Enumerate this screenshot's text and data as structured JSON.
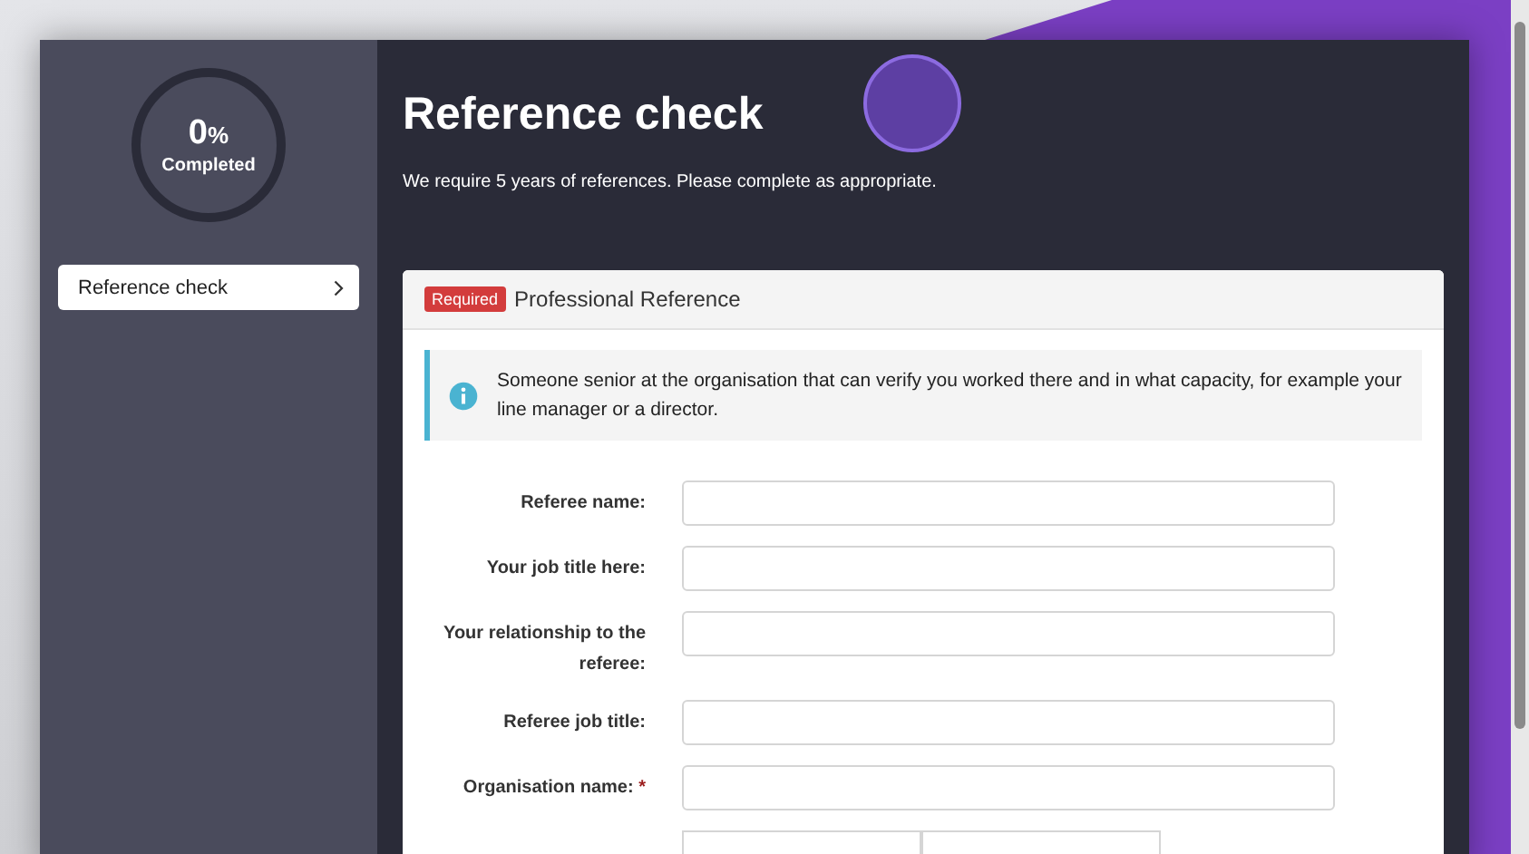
{
  "progress": {
    "percent": "0",
    "unit": "%",
    "label": "Completed",
    "level": 0
  },
  "sidebar": {
    "items": [
      {
        "label": "Reference check",
        "selected": true
      }
    ]
  },
  "header": {
    "title": "Reference check",
    "subtitle": "We require 5 years of references. Please complete as appropriate."
  },
  "card": {
    "badge": "Required",
    "title": "Professional Reference",
    "info": "Someone senior at the organisation that can verify you worked there and in what capacity, for example your line manager or a director.",
    "fields": [
      {
        "kind": "text",
        "label": "Referee name:",
        "required": false
      },
      {
        "kind": "text",
        "label": "Your job title here:",
        "required": false
      },
      {
        "kind": "text",
        "label": "Your relationship to the referee:",
        "required": false
      },
      {
        "kind": "text",
        "label": "Referee job title:",
        "required": false
      },
      {
        "kind": "text",
        "label": "Organisation name:",
        "required": true,
        "required_mark": "*"
      },
      {
        "kind": "daterange"
      }
    ]
  }
}
